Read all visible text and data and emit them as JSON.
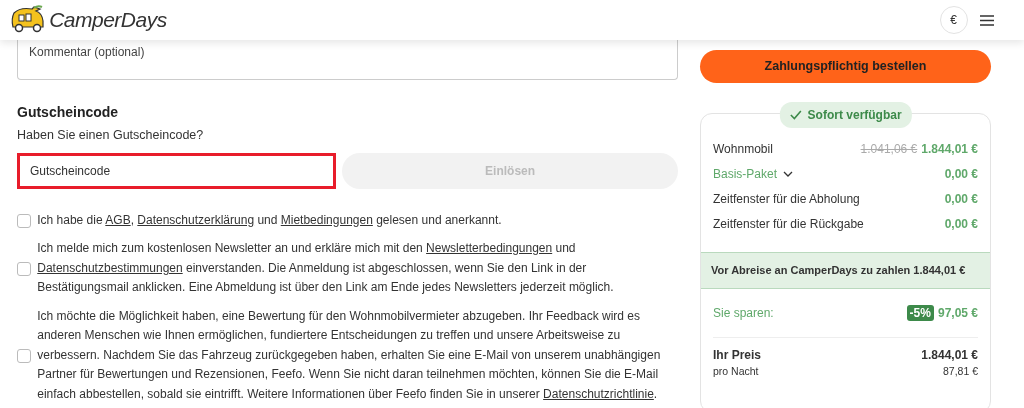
{
  "header": {
    "logo_text": "CamperDays",
    "currency_button": "€"
  },
  "comment": {
    "placeholder": "Kommentar (optional)"
  },
  "voucher": {
    "title": "Gutscheincode",
    "subtitle": "Haben Sie einen Gutscheincode?",
    "placeholder": "Gutscheincode",
    "highlighted": true,
    "button": "Einlösen",
    "button_disabled": true
  },
  "consents": [
    {
      "checked": false,
      "parts": [
        {
          "text": "Ich habe die "
        },
        {
          "text": "AGB",
          "link": true
        },
        {
          "text": ", "
        },
        {
          "text": "Datenschutzerklärung",
          "link": true
        },
        {
          "text": " und "
        },
        {
          "text": "Mietbedingungen",
          "link": true
        },
        {
          "text": " gelesen und anerkannt."
        }
      ]
    },
    {
      "checked": false,
      "parts": [
        {
          "text": "Ich melde mich zum kostenlosen Newsletter an und erkläre mich mit den "
        },
        {
          "text": "Newsletterbedingungen",
          "link": true
        },
        {
          "text": " und "
        },
        {
          "text": "Datenschutzbestimmungen",
          "link": true
        },
        {
          "text": " einverstanden. Die Anmeldung ist abgeschlossen, wenn Sie den Link in der Bestätigungsmail anklicken. Eine Abmeldung ist über den Link am Ende jedes Newsletters jederzeit möglich."
        }
      ]
    },
    {
      "checked": false,
      "parts": [
        {
          "text": "Ich möchte die Möglichkeit haben, eine Bewertung für den Wohnmobilvermieter abzugeben. Ihr Feedback wird es anderen Menschen wie Ihnen ermöglichen, fundiertere Entscheidungen zu treffen und unsere Arbeitsweise zu verbessern. Nachdem Sie das Fahrzeug zurückgegeben haben, erhalten Sie eine E-Mail von unserem unabhängigen Partner für Bewertungen und Rezensionen, Feefo. Wenn Sie nicht daran teilnehmen möchten, können Sie die E-Mail einfach abbestellen, sobald sie eintrifft. Weitere Informationen über Feefo finden Sie in unserer "
        },
        {
          "text": "Datenschutzrichtlinie",
          "link": true
        },
        {
          "text": "."
        }
      ]
    }
  ],
  "order_button": "Zahlungspflichtig bestellen",
  "summary": {
    "badge": "Sofort verfügbar",
    "lines": [
      {
        "label": "Wohnmobil",
        "old_price": "1.041,06 €",
        "price": "1.844,01 €"
      },
      {
        "label": "Basis-Paket",
        "price": "0,00 €",
        "expandable": true
      },
      {
        "label": "Zeitfenster für die Abholung",
        "price": "0,00 €"
      },
      {
        "label": "Zeitfenster für die Rückgabe",
        "price": "0,00 €"
      }
    ],
    "pay_text": "Vor Abreise an CamperDays zu zahlen 1.844,01 €",
    "savings": {
      "label": "Sie sparen:",
      "discount": "-5%",
      "amount": "97,05 €"
    },
    "total": {
      "label": "Ihr Preis",
      "price": "1.844,01 €",
      "per_night_label": "pro Nacht",
      "per_night": "87,81 €"
    }
  }
}
